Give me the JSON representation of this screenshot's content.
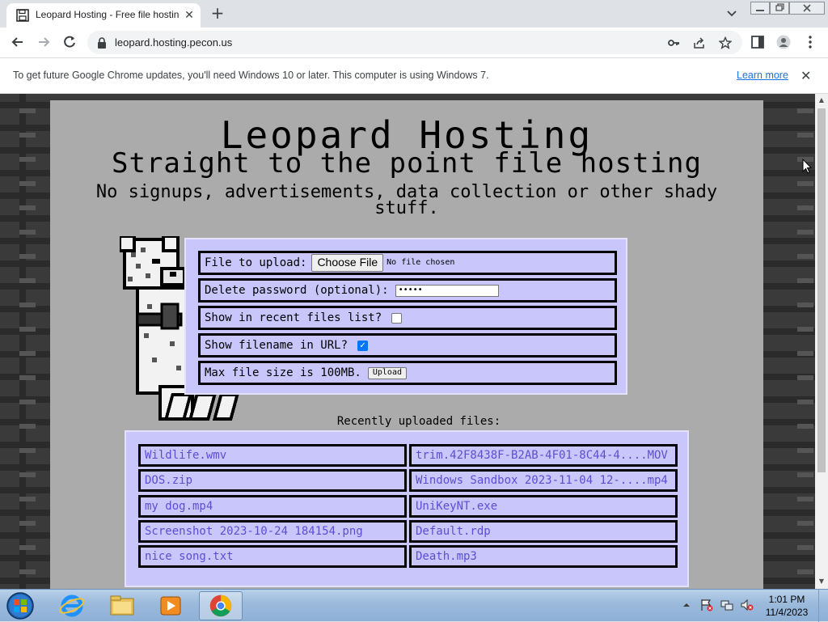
{
  "browser": {
    "tab_title": "Leopard Hosting - Free file hosting",
    "new_tab": "+",
    "tab_close": "✕",
    "url": "leopard.hosting.pecon.us",
    "infobar_text": "To get future Google Chrome updates, you'll need Windows 10 or later. This computer is using Windows 7.",
    "infobar_link": "Learn more",
    "infobar_close": "✕"
  },
  "page": {
    "title": "Leopard Hosting",
    "subtitle": "Straight to the point file hosting",
    "tagline": "No signups, advertisements, data collection or other shady stuff.",
    "form": {
      "file_label": "File to upload:",
      "file_button": "Choose File",
      "file_none": "No file chosen",
      "password_label": "Delete password (optional):",
      "password_value": "•••••",
      "recent_label": "Show in recent files list?",
      "recent_checked": false,
      "filename_label": "Show filename in URL?",
      "filename_checked": true,
      "maxsize_label": "Max file size is 100MB.",
      "upload_button": "Upload"
    },
    "recent_heading": "Recently uploaded files:",
    "recent_files": [
      "Wildlife.wmv",
      "trim.42F8438F-B2AB-4F01-8C44-4....MOV",
      "DOS.zip",
      "Windows Sandbox 2023-11-04 12-....mp4",
      "my dog.mp4",
      "UniKeyNT.exe",
      "Screenshot 2023-10-24 184154.png",
      "Default.rdp",
      "nice song.txt",
      "Death.mp3"
    ]
  },
  "taskbar": {
    "time": "1:01 PM",
    "date": "11/4/2023",
    "apps": [
      "start-orb-icon",
      "internet-explorer-icon",
      "file-explorer-icon",
      "media-player-icon",
      "chrome-icon"
    ]
  },
  "colors": {
    "panel_bg": "#ababab",
    "form_bg": "#c9c6fb",
    "link_text": "#5a4fd4",
    "checkbox_checked": "#0075ff"
  }
}
